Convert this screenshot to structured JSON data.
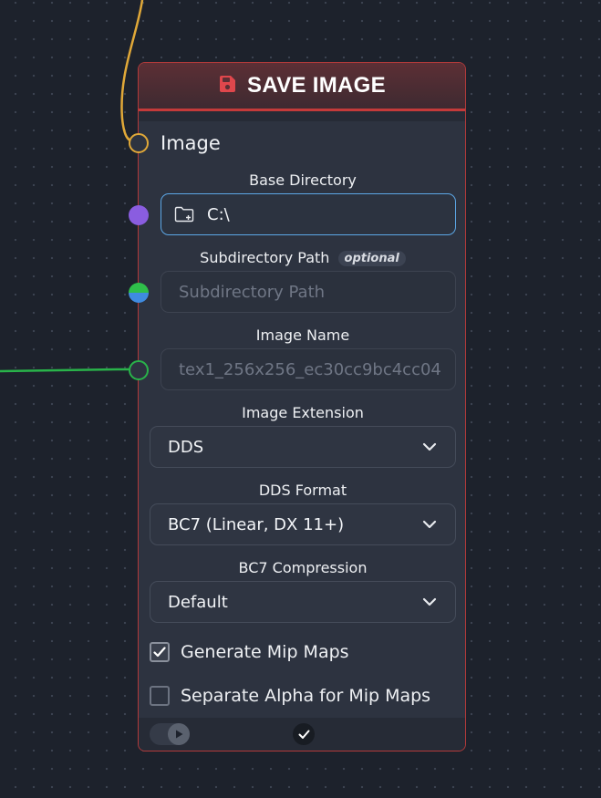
{
  "node": {
    "title": "SAVE IMAGE",
    "icon": "save-icon",
    "accent": "#c43a3a",
    "inputs": {
      "image_label": "Image",
      "base_directory": {
        "label": "Base Directory",
        "value": "C:\\"
      },
      "subdirectory_path": {
        "label": "Subdirectory Path",
        "optional_badge": "optional",
        "placeholder": "Subdirectory Path"
      },
      "image_name": {
        "label": "Image Name",
        "placeholder": "tex1_256x256_ec30cc9bc4cc04"
      }
    },
    "image_extension": {
      "label": "Image Extension",
      "value": "DDS"
    },
    "dds_format": {
      "label": "DDS Format",
      "value": "BC7 (Linear, DX 11+)"
    },
    "bc7_compression": {
      "label": "BC7 Compression",
      "value": "Default"
    },
    "checkboxes": [
      {
        "label": "Generate Mip Maps",
        "checked": true
      },
      {
        "label": "Separate Alpha for Mip Maps",
        "checked": false
      }
    ]
  },
  "colors": {
    "image_socket": "#e0a838",
    "directory_socket": "#8a5de0",
    "subdirectory_socket_top": "#2fbf4a",
    "subdirectory_socket_bottom": "#3f8be0",
    "name_socket": "#29b34a",
    "focus_border": "#5ca7e6"
  }
}
